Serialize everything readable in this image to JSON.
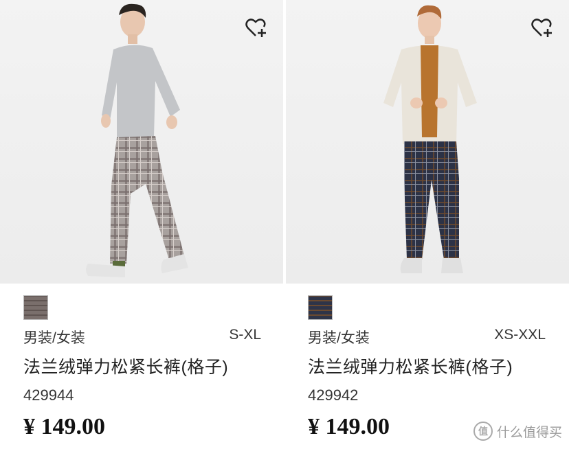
{
  "products": [
    {
      "gender": "男装/女装",
      "size_range": "S-XL",
      "name": "法兰绒弹力松紧长裤(格子)",
      "code": "429944",
      "price": "¥ 149.00",
      "swatch_color": "#b0a8a6",
      "sweater_color": "#c3c5c8",
      "pants_color": "#a59e9b",
      "wishlist_icon": "heart-plus-icon"
    },
    {
      "gender": "男装/女装",
      "size_range": "XS-XXL",
      "name": "法兰绒弹力松紧长裤(格子)",
      "code": "429942",
      "price": "¥ 149.00",
      "swatch_color": "#2e3448",
      "sweater_color": "#e9e4da",
      "pants_color": "#2c3246",
      "wishlist_icon": "heart-plus-icon"
    }
  ],
  "watermark": {
    "logo": "值",
    "text": "什么值得买"
  }
}
